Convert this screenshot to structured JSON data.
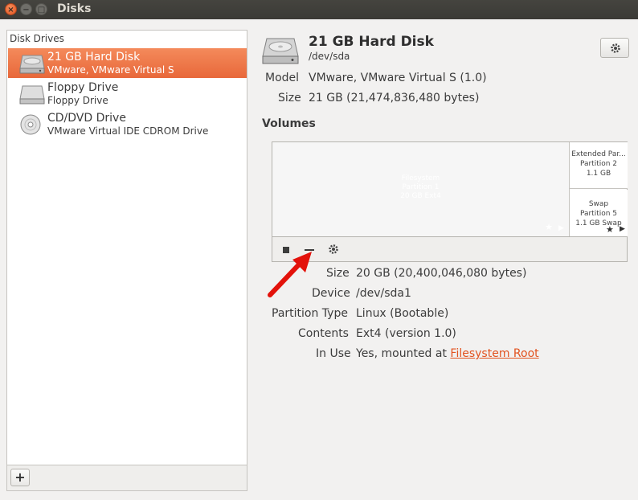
{
  "window": {
    "title": "Disks",
    "buttons": {
      "close": "×",
      "minimize": "−",
      "maximize": "□"
    }
  },
  "sidebar": {
    "header": "Disk Drives",
    "drives": [
      {
        "name": "21 GB Hard Disk",
        "subtitle": "VMware, VMware Virtual S",
        "icon": "hard-disk-icon",
        "selected": true
      },
      {
        "name": "Floppy Drive",
        "subtitle": "Floppy Drive",
        "icon": "floppy-drive-icon",
        "selected": false
      },
      {
        "name": "CD/DVD Drive",
        "subtitle": "VMware Virtual IDE CDROM Drive",
        "icon": "optical-drive-icon",
        "selected": false
      }
    ],
    "add_button": "+"
  },
  "disk": {
    "title": "21 GB Hard Disk",
    "path": "/dev/sda",
    "model_label": "Model",
    "model_value": "VMware, VMware Virtual S (1.0)",
    "size_label": "Size",
    "size_value": "21 GB (21,474,836,480 bytes)"
  },
  "volumes": {
    "title": "Volumes",
    "partitions": [
      {
        "lines": [
          "Filesystem",
          "Partition 1",
          "20 GB Ext4"
        ]
      },
      {
        "lines": [
          "Extended Par...",
          "Partition 2",
          "1.1 GB"
        ]
      },
      {
        "lines": [
          "Swap",
          "Partition 5",
          "1.1 GB Swap"
        ]
      }
    ],
    "star": "★",
    "play": "▶"
  },
  "partition": {
    "size_label": "Size",
    "size_value": "20 GB (20,400,046,080 bytes)",
    "device_label": "Device",
    "device_value": "/dev/sda1",
    "type_label": "Partition Type",
    "type_value": "Linux (Bootable)",
    "contents_label": "Contents",
    "contents_value": "Ext4 (version 1.0)",
    "inuse_label": "In Use",
    "inuse_prefix": "Yes, mounted at ",
    "inuse_link": "Filesystem Root"
  },
  "colors": {
    "accent": "#e8683a",
    "link": "#e2531f",
    "arrow": "#e3120b"
  }
}
